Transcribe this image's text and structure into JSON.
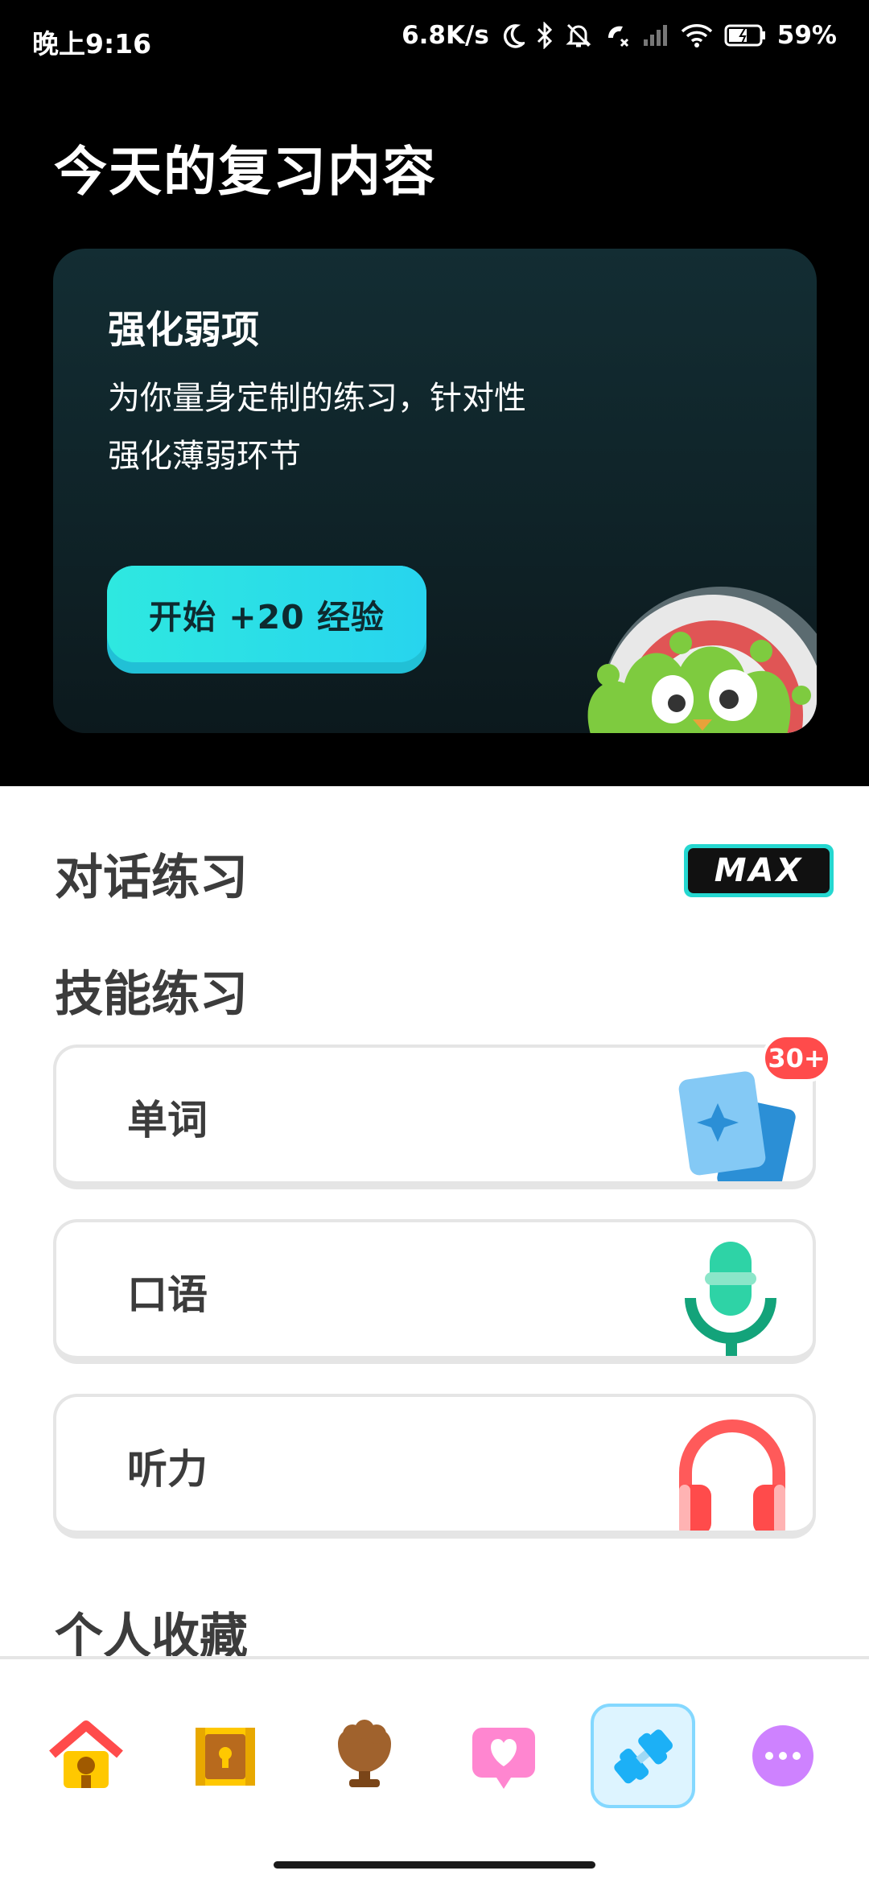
{
  "status_bar": {
    "time": "晚上9:16",
    "speed": "6.8K/s",
    "battery": "59%"
  },
  "review": {
    "title": "今天的复习内容",
    "card": {
      "title": "强化弱项",
      "description": "为你量身定制的练习，针对性强化薄弱环节",
      "start_button": "开始 +20 经验"
    }
  },
  "dialogue": {
    "title": "对话练习",
    "badge": "MAX"
  },
  "skills": {
    "title": "技能练习",
    "items": [
      {
        "label": "单词",
        "icon": "flashcards-icon",
        "badge": "30+"
      },
      {
        "label": "口语",
        "icon": "microphone-icon"
      },
      {
        "label": "听力",
        "icon": "headphones-icon"
      }
    ]
  },
  "favorites": {
    "title": "个人收藏"
  },
  "bottom_nav": {
    "items": [
      {
        "icon": "home-icon"
      },
      {
        "icon": "treasure-chest-icon"
      },
      {
        "icon": "leaderboard-icon"
      },
      {
        "icon": "heart-message-icon"
      },
      {
        "icon": "practice-dumbbell-icon",
        "active": true
      },
      {
        "icon": "more-icon"
      }
    ]
  },
  "colors": {
    "accent": "#2ee8e0",
    "active_nav_bg": "#ddf4ff",
    "badge_red": "#ff4b4b"
  }
}
